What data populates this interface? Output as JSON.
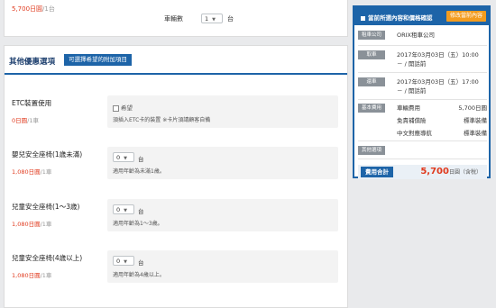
{
  "top": {
    "price": "5,700日圓",
    "price_unit": "/1台",
    "car_count_label": "車輛數",
    "car_count_value": "1",
    "car_count_unit": "台"
  },
  "options": {
    "title": "其他優惠選項",
    "tag": "可選擇希望的附加項目",
    "items": [
      {
        "name": "ETC裝置使用",
        "price": "0日圓",
        "unit": "/1車",
        "check_label": "希望",
        "note": "須插入ETC卡的裝置 ※卡片須請顧客自備"
      },
      {
        "name": "嬰兒安全座椅(1歳未滿)",
        "price": "1,080日圓",
        "unit": "/1車",
        "select": "0",
        "select_unit": "台",
        "note": "適用年齡為未滿1歳。"
      },
      {
        "name": "兒童安全座椅(1～3歳)",
        "price": "1,080日圓",
        "unit": "/1車",
        "select": "0",
        "select_unit": "台",
        "note": "適用年齡為1～3歳。"
      },
      {
        "name": "兒童安全座椅(4歳以上)",
        "price": "1,080日圓",
        "unit": "/1車",
        "select": "0",
        "select_unit": "台",
        "note": "適用年齡為4歳以上。"
      }
    ]
  },
  "summary": {
    "title": "當前所選內容和價格確認",
    "edit": "修改當前內容",
    "company_label": "租車公司",
    "company": "ORIX租車公司",
    "pickup_label": "取車",
    "pickup_date": "2017年03月03日（五）10:00",
    "pickup_place": "－ / 開話前",
    "return_label": "還車",
    "return_date": "2017年03月03日（五）17:00",
    "return_place": "－ / 開話前",
    "base_label": "基本費用",
    "base_rows": [
      {
        "name": "車輛費用",
        "value": "5,700日圓"
      },
      {
        "name": "免責補償險",
        "value": "標準裝備"
      },
      {
        "name": "中文對應導航",
        "value": "標準裝備"
      }
    ],
    "option_label": "其他選項",
    "total_label": "費用合計",
    "total_value": "5,700",
    "total_unit": "日圓（含稅）"
  }
}
